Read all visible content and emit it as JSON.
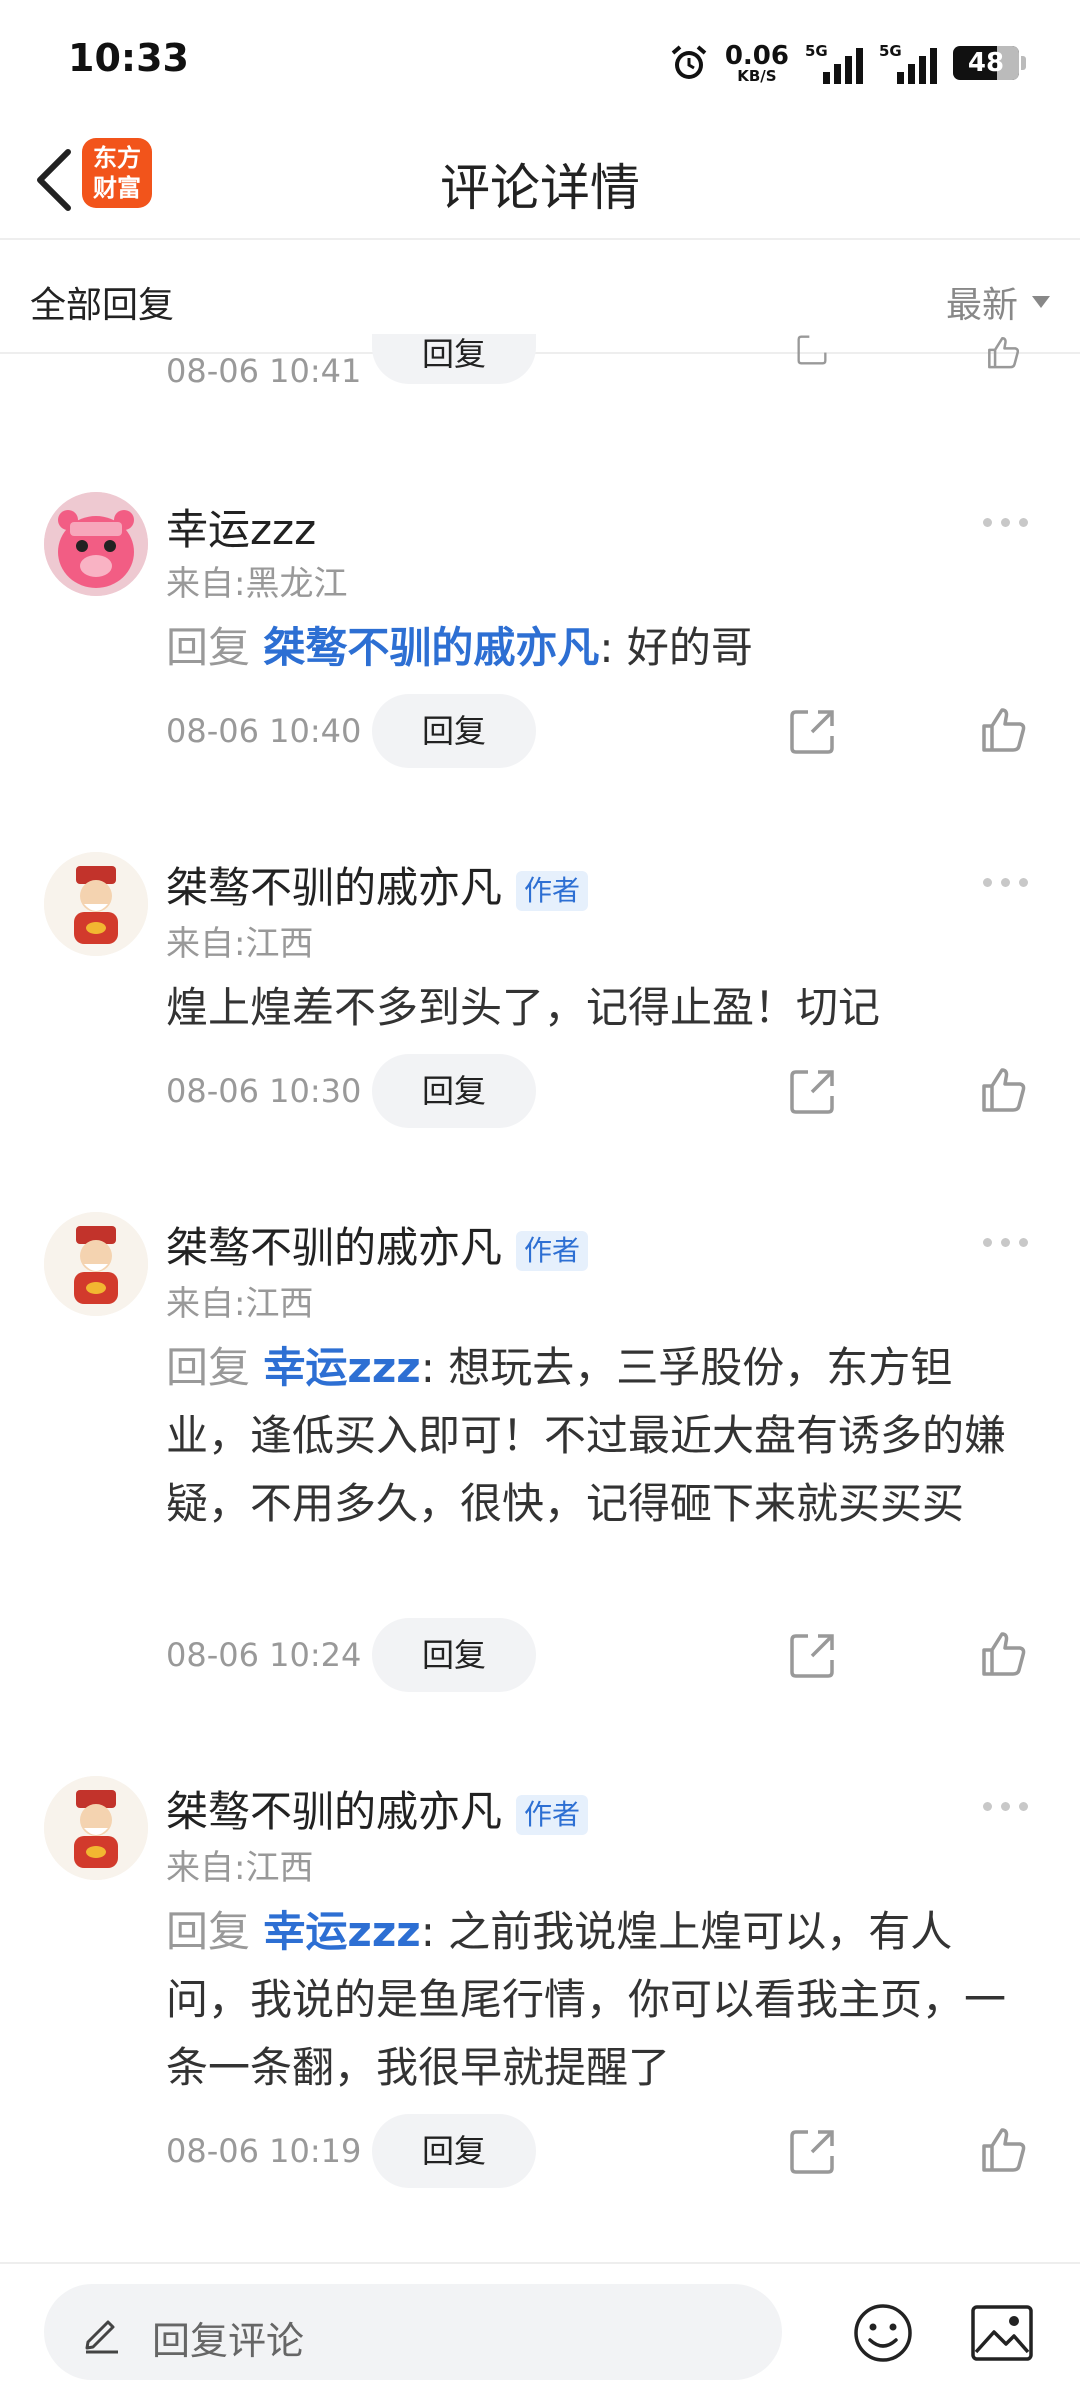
{
  "status_bar": {
    "time": "10:33",
    "net_speed": "0.06",
    "net_unit": "KB/S",
    "sim1": "5G",
    "sim2": "5G",
    "battery": "48"
  },
  "nav": {
    "logo_text_line1": "东方",
    "logo_text_line2": "财富",
    "title": "评论详情"
  },
  "filter": {
    "all_replies": "全部回复",
    "sort": "最新"
  },
  "partial_row": {
    "time": "08-06 10:41",
    "reply_label": "回复"
  },
  "comments": [
    {
      "username": "幸运zzz",
      "author_badge": "",
      "location": "来自:黑龙江",
      "reply_prefix": "回复",
      "reply_to": "桀骜不驯的戚亦凡",
      "text": ": 好的哥",
      "time": "08-06 10:40",
      "reply_label": "回复"
    },
    {
      "username": "桀骜不驯的戚亦凡",
      "author_badge": "作者",
      "location": "来自:江西",
      "reply_prefix": "",
      "reply_to": "",
      "text": "煌上煌差不多到头了，记得止盈！切记",
      "time": "08-06 10:30",
      "reply_label": "回复"
    },
    {
      "username": "桀骜不驯的戚亦凡",
      "author_badge": "作者",
      "location": "来自:江西",
      "reply_prefix": "回复",
      "reply_to": "幸运zzz",
      "text": ": 想玩去，三孚股份，东方钽业，逢低买入即可！不过最近大盘有诱多的嫌疑，不用多久，很快，记得砸下来就买买买",
      "time": "08-06 10:24",
      "reply_label": "回复"
    },
    {
      "username": "桀骜不驯的戚亦凡",
      "author_badge": "作者",
      "location": "来自:江西",
      "reply_prefix": "回复",
      "reply_to": "幸运zzz",
      "text": ": 之前我说煌上煌可以，有人问，我说的是鱼尾行情，你可以看我主页，一条一条翻，我很早就提醒了",
      "time": "08-06 10:19",
      "reply_label": "回复"
    }
  ],
  "reply_bar": {
    "placeholder": "回复评论"
  },
  "colors": {
    "accent_blue": "#2d6fd3",
    "logo_orange": "#f2541b",
    "muted_gray": "#999999",
    "button_bg": "#f2f3f5"
  }
}
